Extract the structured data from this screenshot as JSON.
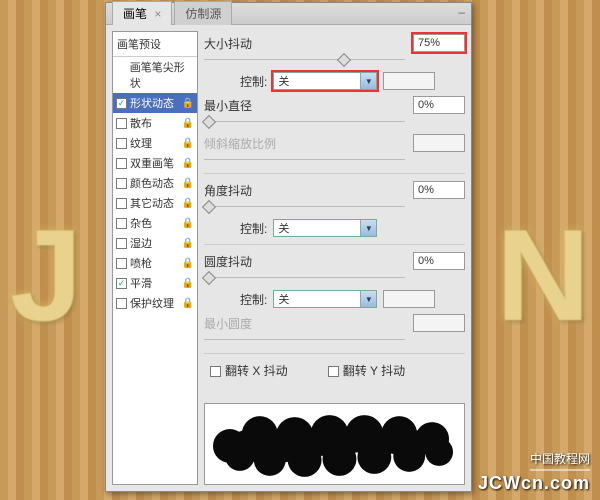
{
  "bg": {
    "letter_left": "J",
    "letter_right": "N"
  },
  "watermark": {
    "cn": "中国教程网",
    "url": "JCWcn.com"
  },
  "tabs": {
    "brush": "画笔",
    "clone": "仿制源"
  },
  "minimize": "–",
  "sidebar": {
    "preset": "画笔预设",
    "items": [
      {
        "label": "画笔笔尖形状",
        "checked": null,
        "lock": false
      },
      {
        "label": "形状动态",
        "checked": true,
        "lock": true,
        "selected": true
      },
      {
        "label": "散布",
        "checked": false,
        "lock": true
      },
      {
        "label": "纹理",
        "checked": false,
        "lock": true
      },
      {
        "label": "双重画笔",
        "checked": false,
        "lock": true
      },
      {
        "label": "颜色动态",
        "checked": false,
        "lock": true
      },
      {
        "label": "其它动态",
        "checked": false,
        "lock": true
      },
      {
        "label": "杂色",
        "checked": false,
        "lock": true
      },
      {
        "label": "湿边",
        "checked": false,
        "lock": true
      },
      {
        "label": "喷枪",
        "checked": false,
        "lock": true
      },
      {
        "label": "平滑",
        "checked": true,
        "lock": true
      },
      {
        "label": "保护纹理",
        "checked": false,
        "lock": true
      }
    ]
  },
  "main": {
    "size_jitter": "大小抖动",
    "size_jitter_val": "75%",
    "control": "控制:",
    "control_off": "关",
    "min_diameter": "最小直径",
    "min_diameter_val": "0%",
    "tilt_scale": "倾斜缩放比例",
    "angle_jitter": "角度抖动",
    "angle_jitter_val": "0%",
    "roundness_jitter": "圆度抖动",
    "roundness_jitter_val": "0%",
    "min_roundness": "最小圆度",
    "flip_x": "翻转 X 抖动",
    "flip_y": "翻转 Y 抖动"
  }
}
